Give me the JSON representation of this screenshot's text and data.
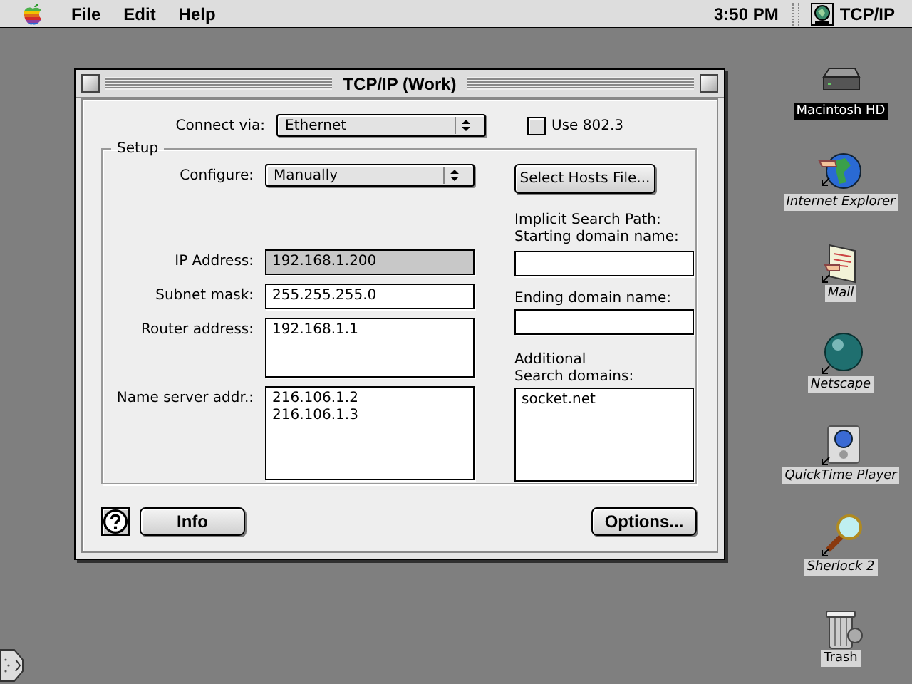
{
  "menu_bar": {
    "menus": [
      {
        "label": "File"
      },
      {
        "label": "Edit"
      },
      {
        "label": "Help"
      }
    ],
    "clock": "3:50 PM",
    "app": "TCP/IP"
  },
  "window": {
    "title": "TCP/IP (Work)",
    "connect_via": {
      "label": "Connect via:",
      "value": "Ethernet"
    },
    "use_802_3": {
      "label": "Use 802.3",
      "checked": false
    },
    "setup": {
      "title": "Setup",
      "configure": {
        "label": "Configure:",
        "value": "Manually"
      },
      "fields": [
        {
          "label": "IP Address:",
          "lines": [
            "192.168.1.200"
          ],
          "editable": false
        },
        {
          "label": "Subnet mask:",
          "lines": [
            "255.255.255.0"
          ],
          "editable": true
        },
        {
          "label": "Router address:",
          "lines": [
            "192.168.1.1"
          ],
          "editable": true
        },
        {
          "label": "Name server addr.:",
          "lines": [
            "216.106.1.2",
            "216.106.1.3"
          ],
          "editable": true
        }
      ],
      "select_hosts_button": "Select Hosts File...",
      "right_fields": [
        {
          "label_lines": [
            "Implicit Search Path:",
            "Starting domain name:"
          ]
        },
        {
          "label_lines": [
            "Ending domain name:"
          ]
        },
        {
          "label_lines": [
            "Additional",
            "Search domains:"
          ],
          "lines": [
            "socket.net"
          ]
        }
      ]
    },
    "buttons": [
      {
        "label": "Info"
      },
      {
        "label": "Options..."
      }
    ]
  },
  "desktop_icons": [
    {
      "label": "Macintosh HD",
      "selected": true,
      "alias": false
    },
    {
      "label": "Internet Explorer",
      "selected": false,
      "alias": true
    },
    {
      "label": "Mail",
      "selected": false,
      "alias": true
    },
    {
      "label": "Netscape",
      "selected": false,
      "alias": true
    },
    {
      "label": "QuickTime Player",
      "selected": false,
      "alias": true
    },
    {
      "label": "Sherlock 2",
      "selected": false,
      "alias": true
    },
    {
      "label": "Trash",
      "selected": false,
      "alias": false
    }
  ]
}
